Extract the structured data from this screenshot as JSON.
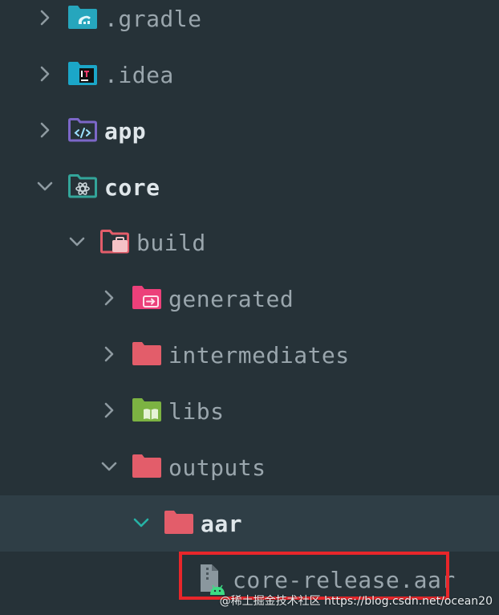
{
  "tree": {
    "items": [
      {
        "label": "gradle_dir",
        "text": ".gradle",
        "icon": "gradle-folder-icon",
        "state": "collapsed"
      },
      {
        "label": "idea_dir",
        "text": ".idea",
        "icon": "idea-folder-icon",
        "state": "collapsed"
      },
      {
        "label": "app_dir",
        "text": "app",
        "icon": "app-module-folder-icon",
        "state": "collapsed"
      },
      {
        "label": "core_dir",
        "text": "core",
        "icon": "core-module-folder-icon",
        "state": "expanded"
      },
      {
        "label": "build_dir",
        "text": "build",
        "icon": "build-folder-icon",
        "state": "expanded"
      },
      {
        "label": "generated_dir",
        "text": "generated",
        "icon": "generated-folder-icon",
        "state": "collapsed"
      },
      {
        "label": "intermediates_dir",
        "text": "intermediates",
        "icon": "folder-icon",
        "state": "collapsed"
      },
      {
        "label": "libs_dir",
        "text": "libs",
        "icon": "libs-folder-icon",
        "state": "collapsed"
      },
      {
        "label": "outputs_dir",
        "text": "outputs",
        "icon": "folder-icon",
        "state": "expanded"
      },
      {
        "label": "aar_dir",
        "text": "aar",
        "icon": "folder-icon",
        "state": "expanded"
      },
      {
        "label": "aar_file",
        "text": "core-release.aar",
        "icon": "android-archive-file-icon",
        "state": "file"
      }
    ]
  },
  "colors": {
    "background": "#263238",
    "selected_row": "#2f3e46",
    "teal_folder": "#26a6bd",
    "idea_folder": "#1ba6c8",
    "app_folder": "#7c67c8",
    "core_folder": "#33a59a",
    "red_folder": "#e35d6a",
    "pink_folder": "#ec407a",
    "green_folder": "#7cb342",
    "highlight": "#e8262a",
    "android_green": "#3ddc84"
  },
  "watermark": "@稀土掘金技术社区 https://blog.csdn.net/ocean20"
}
